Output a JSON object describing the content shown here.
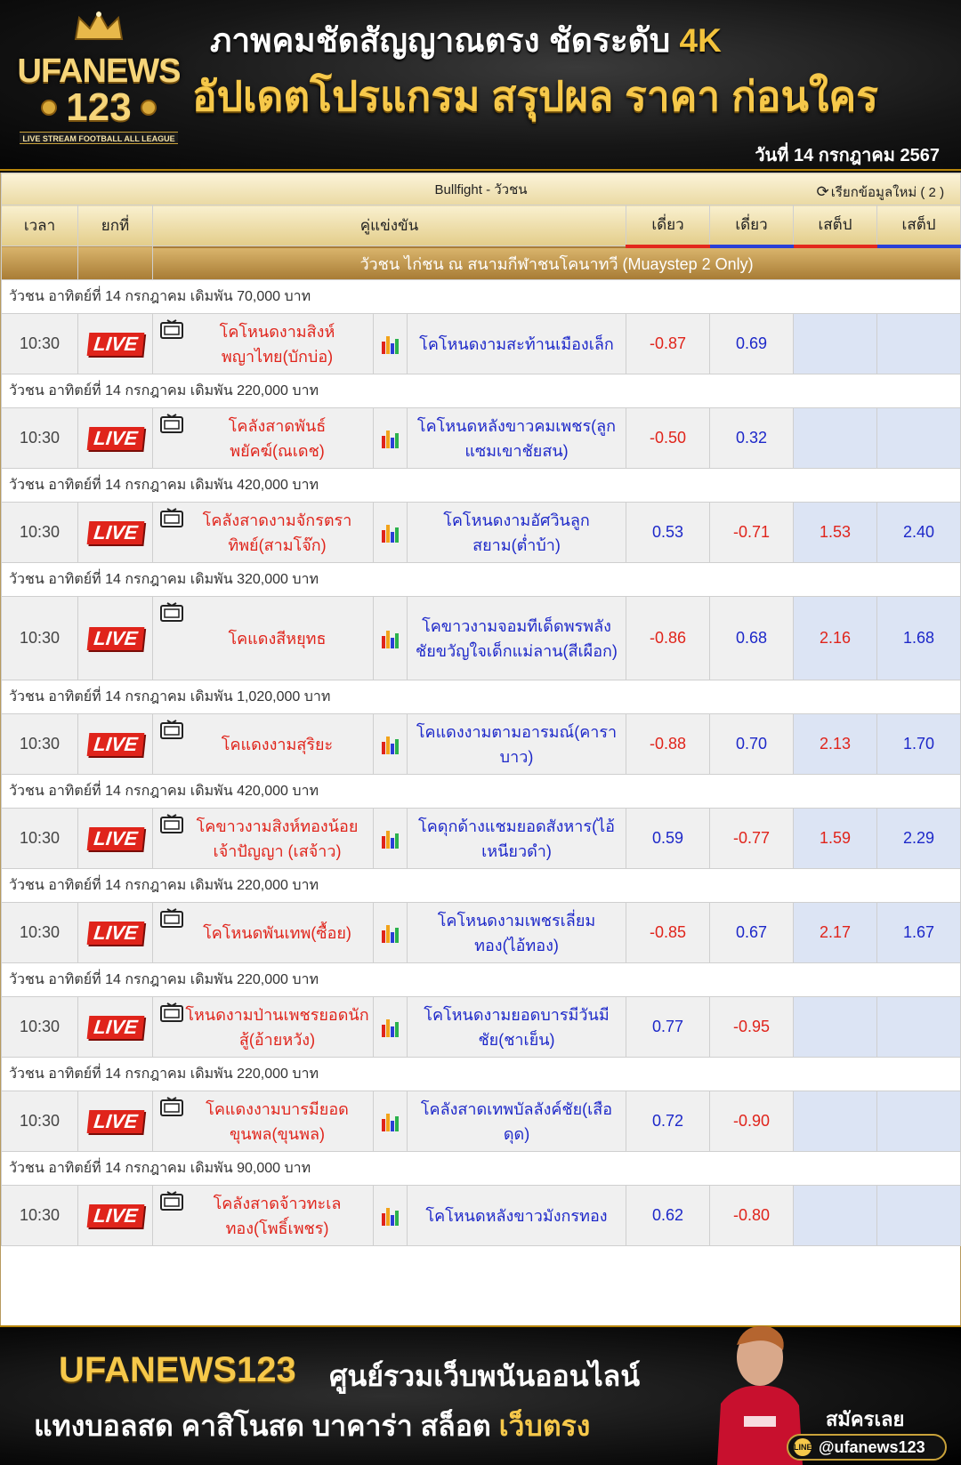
{
  "banner": {
    "logo_word": "UFANEWS",
    "logo_num": "123",
    "logo_tag": "LIVE STREAM FOOTBALL ALL LEAGUE",
    "headline_1": "ภาพคมชัดสัญญาณตรง ชัดระดับ",
    "headline_1_accent": "4K",
    "headline_2": "อัปเดตโปรแกรม สรุปผล ราคา ก่อนใคร",
    "date": "วันที่ 14 กรกฎาคม 2567"
  },
  "table": {
    "title": "Bullfight - วัวชน",
    "refresh_label": "เรียกข้อมูลใหม่ ( 2 )",
    "headers": {
      "time": "เวลา",
      "round": "ยกที่",
      "match": "คู่แข่งขัน",
      "single_1": "เดี่ยว",
      "single_2": "เดี่ยว",
      "step_1": "เสต็ป",
      "step_2": "เสต็ป"
    },
    "league": "วัวชน ไก่ชน ณ สนามกีฬาชนโคนาทวี (Muaystep 2 Only)",
    "live_label": "LIVE",
    "matches": [
      {
        "info": "วัวชน อาทิตย์ที่ 14 กรกฎาคม เดิมพัน 70,000 บาท",
        "time": "10:30",
        "home": "โคโหนดงามสิงห์พญาไทย(บักบ่อ)",
        "away": "โคโหนดงามสะท้านเมืองเล็ก",
        "odd1": "-0.87",
        "odd2": "0.69",
        "step1": "",
        "step2": ""
      },
      {
        "info": "วัวชน อาทิตย์ที่ 14 กรกฎาคม เดิมพัน 220,000 บาท",
        "time": "10:30",
        "home": "โคลังสาดพันธ์พยัคฆ์(ณเดช)",
        "away": "โคโหนดหลังขาวคมเพชร(ลูกแซมเขาชัยสน)",
        "odd1": "-0.50",
        "odd2": "0.32",
        "step1": "",
        "step2": ""
      },
      {
        "info": "วัวชน อาทิตย์ที่ 14 กรกฎาคม เดิมพัน 420,000 บาท",
        "time": "10:30",
        "home": "โคลังสาดงามจักรตราทิพย์(สามโจ๊ก)",
        "away": "โคโหนดงามอัศวินลูกสยาม(ต่ำบ้า)",
        "odd1": "0.53",
        "odd2": "-0.71",
        "step1": "1.53",
        "step2": "2.40"
      },
      {
        "info": "วัวชน อาทิตย์ที่ 14 กรกฎาคม เดิมพัน 320,000 บาท",
        "time": "10:30",
        "home": "โคแดงสีหยุทธ",
        "away": "โคขาวงามจอมทีเด็ดพรพลังชัยขวัญใจเด็กแม่ลาน(สีเผือก)",
        "odd1": "-0.86",
        "odd2": "0.68",
        "step1": "2.16",
        "step2": "1.68"
      },
      {
        "info": "วัวชน อาทิตย์ที่ 14 กรกฎาคม เดิมพัน 1,020,000 บาท",
        "time": "10:30",
        "home": "โคแดงงามสุริยะ",
        "away": "โคแดงงามตามอารมณ์(คาราบาว)",
        "odd1": "-0.88",
        "odd2": "0.70",
        "step1": "2.13",
        "step2": "1.70"
      },
      {
        "info": "วัวชน อาทิตย์ที่ 14 กรกฎาคม เดิมพัน 420,000 บาท",
        "time": "10:30",
        "home": "โคขาวงามสิงห์ทองน้อยเจ้าปัญญา (เสจ้าว)",
        "away": "โคดุกด้างแชมยอดสังหาร(ไอ้เหนียวดำ)",
        "odd1": "0.59",
        "odd2": "-0.77",
        "step1": "1.59",
        "step2": "2.29"
      },
      {
        "info": "วัวชน อาทิตย์ที่ 14 กรกฎาคม เดิมพัน 220,000 บาท",
        "time": "10:30",
        "home": "โคโหนดพันเทพ(ซื้อย)",
        "away": "โคโหนดงามเพชรเลี่ยมทอง(ไอ้ทอง)",
        "odd1": "-0.85",
        "odd2": "0.67",
        "step1": "2.17",
        "step2": "1.67"
      },
      {
        "info": "วัวชน อาทิตย์ที่ 14 กรกฎาคม เดิมพัน 220,000 บาท",
        "time": "10:30",
        "home": "โหนดงามป่านเพชรยอดนักสู้(อ้ายหวัง)",
        "away": "โคโหนดงามยอดบารมีวันมีชัย(ชาเย็น)",
        "odd1": "0.77",
        "odd2": "-0.95",
        "step1": "",
        "step2": ""
      },
      {
        "info": "วัวชน อาทิตย์ที่ 14 กรกฎาคม เดิมพัน 220,000 บาท",
        "time": "10:30",
        "home": "โคแดงงามบารมียอดขุนพล(ขุนพล)",
        "away": "โคลังสาดเทพบัลลังค์ชัย(เสือดุด)",
        "odd1": "0.72",
        "odd2": "-0.90",
        "step1": "",
        "step2": ""
      },
      {
        "info": "วัวชน อาทิตย์ที่ 14 กรกฎาคม เดิมพัน 90,000 บาท",
        "time": "10:30",
        "home": "โคลังสาดจ้าวทะเลทอง(โพธิ์เพชร)",
        "away": "โคโหนดหลังขาวมังกรทอง",
        "odd1": "0.62",
        "odd2": "-0.80",
        "step1": "",
        "step2": ""
      }
    ]
  },
  "footer": {
    "brand": "UFANEWS123",
    "tagline_1": "ศูนย์รวมเว็บพนันออนไลน์",
    "tagline_2": "แทงบอลสด คาสิโนสด บาคาร่า สล็อต",
    "tagline_2_accent": "เว็บตรง",
    "signup": "สมัครเลย",
    "line_id": "@ufanews123",
    "line_icon_text": "LINE"
  },
  "colors": {
    "gold": "#f6c84a",
    "negative_odds": "#e0241b",
    "positive_odds": "#1d28c9",
    "live_badge": "#e0241b",
    "step_cell_bg": "#dce4f4"
  },
  "icons": {
    "refresh": "refresh-icon",
    "tv": "tv-icon",
    "stats": "stats-icon",
    "crown": "crown-icon"
  }
}
